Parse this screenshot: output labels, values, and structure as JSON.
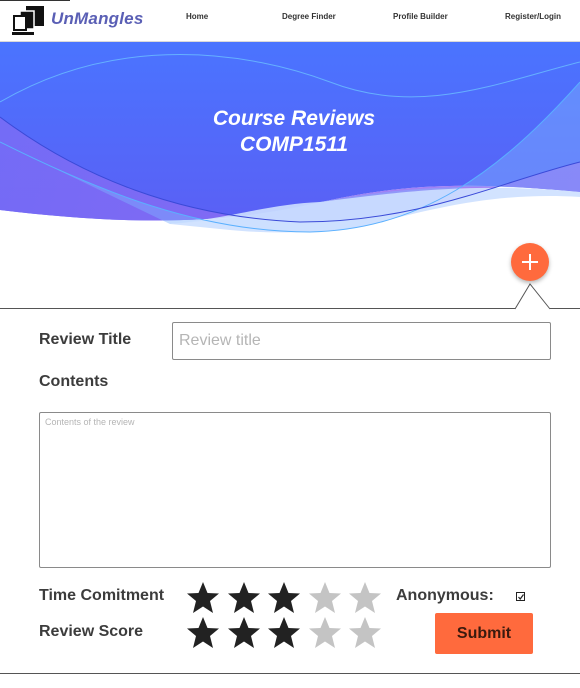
{
  "navbar": {
    "brand": "UnMangles",
    "links": [
      "Home",
      "Degree Finder",
      "Profile Builder",
      "Register/Login"
    ]
  },
  "hero": {
    "title_line1": "Course Reviews",
    "title_line2": "COMP1511"
  },
  "form": {
    "review_title_label": "Review Title",
    "review_title_placeholder": "Review title",
    "contents_label": "Contents",
    "contents_placeholder": "Contents of the review",
    "time_commitment_label": "Time Comitment",
    "time_commitment_rating": 3,
    "review_score_label": "Review Score",
    "review_score_rating": 3,
    "max_rating": 5,
    "anonymous_label": "Anonymous:",
    "anonymous_checked": true,
    "submit_label": "Submit"
  },
  "colors": {
    "accent": "#ff6a3d",
    "brand": "#5a5fb5",
    "hero_blue": "#4f6bff",
    "hero_purple": "#8a63f0",
    "star_filled": "#222222",
    "star_empty": "#c4c4c4"
  },
  "icons": {
    "logo": "books-stack-icon",
    "fab": "plus-icon",
    "star": "star-icon",
    "checkbox": "check-icon"
  }
}
